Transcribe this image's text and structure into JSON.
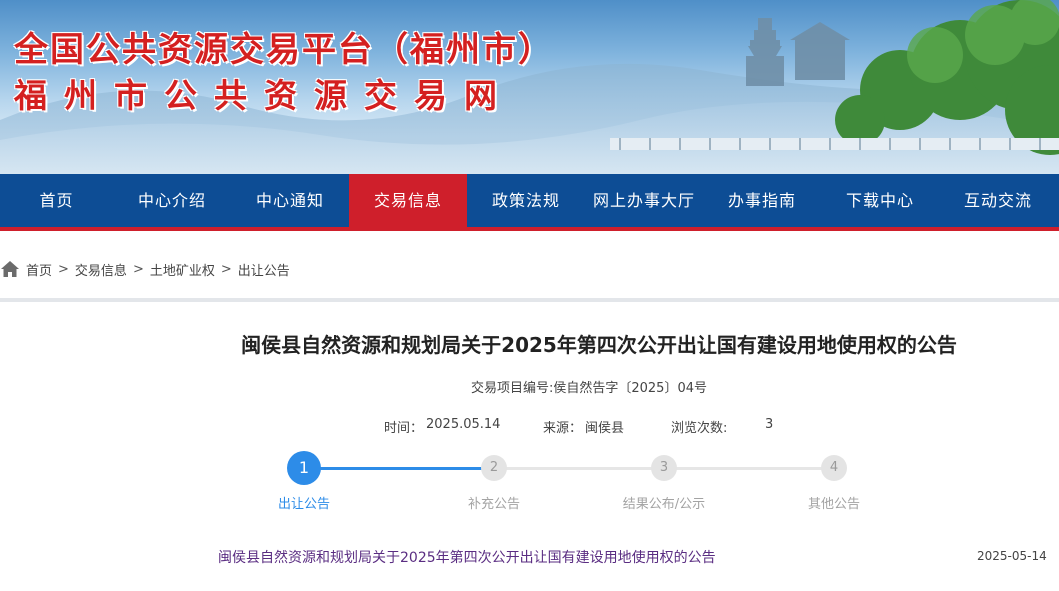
{
  "banner": {
    "title_line1": "全国公共资源交易平台（福州市）",
    "title_line2": "福州市公共资源交易网",
    "title_color": "#d42020"
  },
  "nav": {
    "items": [
      {
        "label": "首页"
      },
      {
        "label": "中心介绍"
      },
      {
        "label": "中心通知"
      },
      {
        "label": "交易信息",
        "active": true
      },
      {
        "label": "政策法规"
      },
      {
        "label": "网上办事大厅"
      },
      {
        "label": "办事指南"
      },
      {
        "label": "下载中心"
      },
      {
        "label": "互动交流"
      }
    ],
    "bg_color": "#0d4d95",
    "active_color": "#cf1f2b"
  },
  "breadcrumb": {
    "icon": "home-icon",
    "items": [
      "首页",
      "交易信息",
      "土地矿业权",
      "出让公告"
    ],
    "separator": ">"
  },
  "article": {
    "title": "闽侯县自然资源和规划局关于2025年第四次公开出让国有建设用地使用权的公告",
    "project_no": "交易项目编号:侯自然告字〔2025〕04号",
    "time_label": "时间：",
    "time_value": "2025.05.14",
    "source_label": "来源：",
    "source_value": "闽侯县",
    "views_label": "浏览次数:",
    "views_value": "3"
  },
  "steps": [
    {
      "num": "1",
      "label": "出让公告",
      "active": true
    },
    {
      "num": "2",
      "label": "补充公告",
      "active": false
    },
    {
      "num": "3",
      "label": "结果公布/公示",
      "active": false
    },
    {
      "num": "4",
      "label": "其他公告",
      "active": false
    }
  ],
  "list": [
    {
      "title": "闽侯县自然资源和规划局关于2025年第四次公开出让国有建设用地使用权的公告",
      "date": "2025-05-14"
    }
  ],
  "colors": {
    "step_active": "#2d8ce8",
    "step_inactive": "#e4e4e4",
    "link_visited": "#5a2d82"
  }
}
